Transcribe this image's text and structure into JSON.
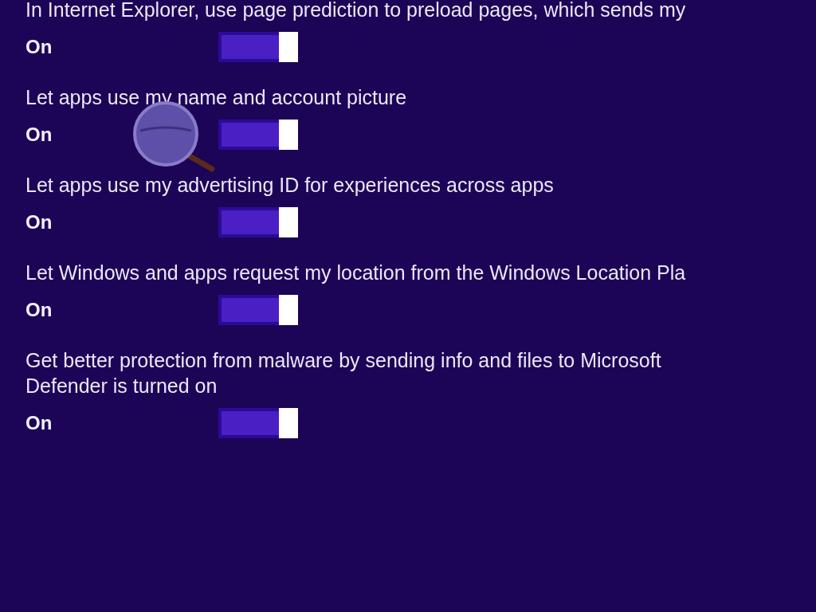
{
  "settings": [
    {
      "label": "In Internet Explorer, use page prediction to preload pages, which sends my",
      "state_text": "On",
      "on": true
    },
    {
      "label": "Let apps use my name and account picture",
      "state_text": "On",
      "on": true
    },
    {
      "label": "Let apps use my advertising ID for experiences across apps",
      "state_text": "On",
      "on": true
    },
    {
      "label": "Let Windows and apps request my location from the Windows Location Pla",
      "state_text": "On",
      "on": true
    },
    {
      "label": "Get better protection from malware by sending info and files to Microsoft\nDefender is turned on",
      "state_text": "On",
      "on": true
    }
  ]
}
